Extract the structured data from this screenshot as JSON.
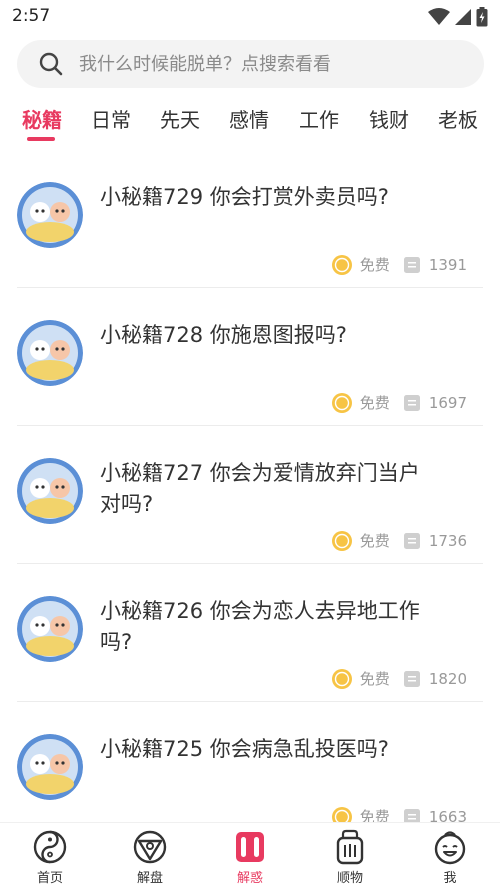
{
  "status_bar": {
    "time": "2:57"
  },
  "search": {
    "placeholder": "我什么时候能脱单？点搜索看看"
  },
  "tabs": [
    {
      "label": "秘籍",
      "active": true
    },
    {
      "label": "日常"
    },
    {
      "label": "先天"
    },
    {
      "label": "感情"
    },
    {
      "label": "工作"
    },
    {
      "label": "钱财"
    },
    {
      "label": "老板"
    }
  ],
  "items": [
    {
      "title": "小秘籍729  你会打赏外卖员吗?",
      "price": "免费",
      "views": "1391"
    },
    {
      "title": "小秘籍728  你施恩图报吗?",
      "price": "免费",
      "views": "1697"
    },
    {
      "title": "小秘籍727  你会为爱情放弃门当户对吗?",
      "price": "免费",
      "views": "1736"
    },
    {
      "title": "小秘籍726  你会为恋人去异地工作吗?",
      "price": "免费",
      "views": "1820"
    },
    {
      "title": "小秘籍725  你会病急乱投医吗?",
      "price": "免费",
      "views": "1663"
    }
  ],
  "bottom_nav": [
    {
      "label": "首页",
      "icon": "yin-yang-icon"
    },
    {
      "label": "解盘",
      "icon": "compass-icon"
    },
    {
      "label": "解惑",
      "icon": "scroll-icon",
      "active": true
    },
    {
      "label": "顺物",
      "icon": "bag-icon"
    },
    {
      "label": "我",
      "icon": "face-icon"
    }
  ],
  "colors": {
    "accent": "#e83a60",
    "coin": "#f7c445",
    "divider": "#ececec"
  }
}
